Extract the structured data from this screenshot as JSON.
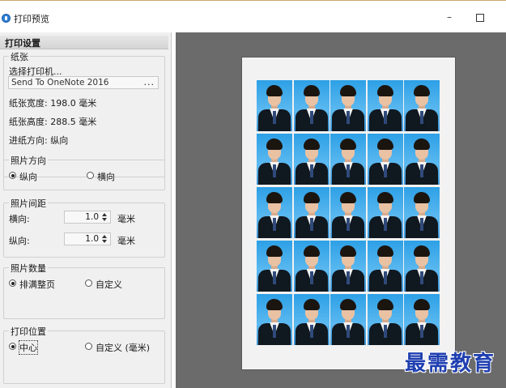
{
  "window": {
    "title": "打印预览",
    "minimize_label": "–",
    "maximize_label": ""
  },
  "panel": {
    "header": "打印设置",
    "paper": {
      "title": "纸张",
      "choose_printer": "选择打印机...",
      "printer_value": "Send To OneNote 2016",
      "browse_label": "...",
      "width": "纸张宽度: 198.0 毫米",
      "height": "纸张高度: 288.5 毫米",
      "feed": "进纸方向: 纵向"
    },
    "orientation": {
      "title": "照片方向",
      "portrait": "纵向",
      "landscape": "横向",
      "selected": "portrait"
    },
    "spacing": {
      "title": "照片间距",
      "horizontal_label": "横向:",
      "horizontal_value": "1.0",
      "vertical_label": "纵向:",
      "vertical_value": "1.0",
      "unit": "毫米"
    },
    "count": {
      "title": "照片数量",
      "fill_page": "排满整页",
      "custom": "自定义",
      "selected": "fill_page"
    },
    "position": {
      "title": "打印位置",
      "center": "中心",
      "custom": "自定义 (毫米)",
      "selected": "center"
    }
  },
  "preview": {
    "rows": 5,
    "cols": 5
  },
  "watermark": "最需教育",
  "colors": {
    "preview_bg": "#6b6b6b",
    "panel_bg": "#f0f0f0",
    "photo_bg": "#2da0e6",
    "watermark": "#1f3fb0"
  }
}
